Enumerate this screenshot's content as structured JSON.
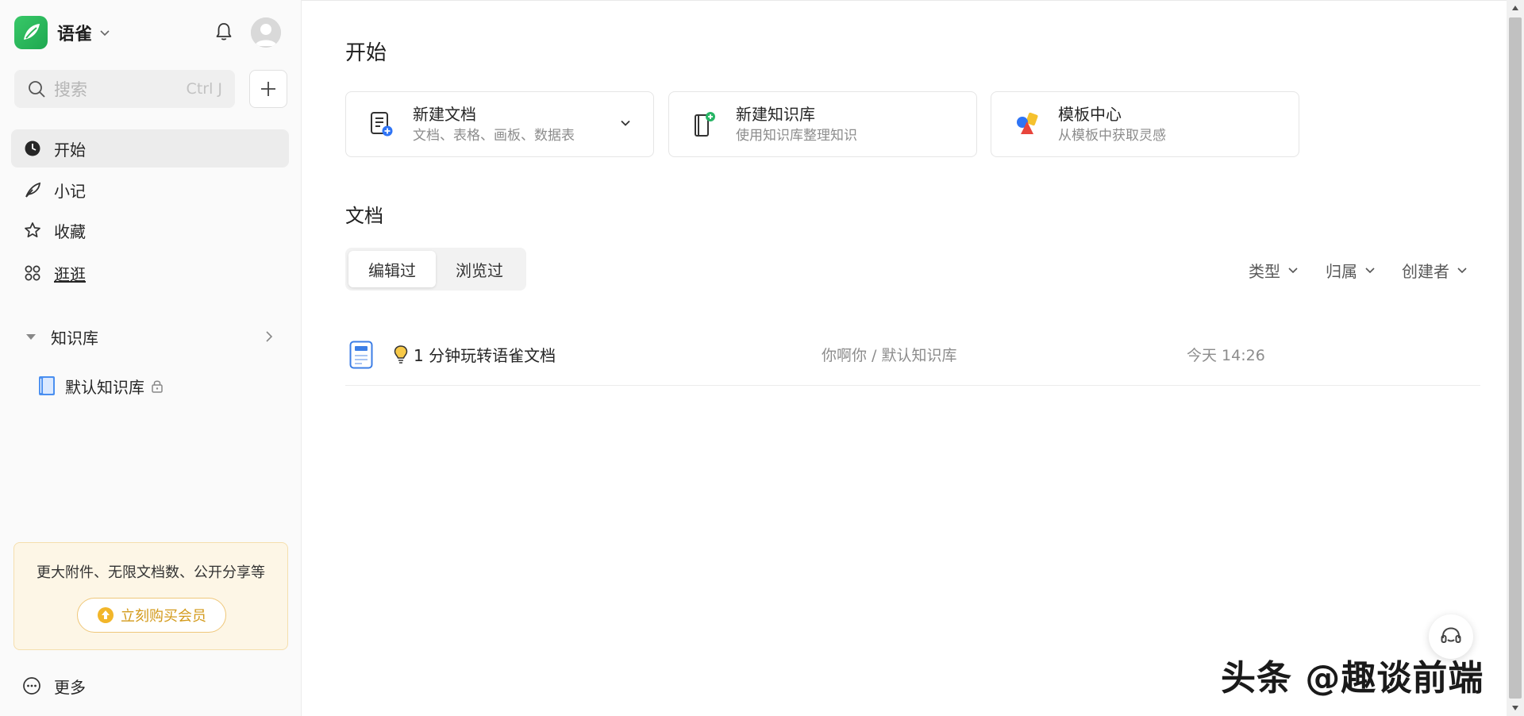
{
  "brand": {
    "name": "语雀",
    "accent": "#2fb85a"
  },
  "search": {
    "placeholder": "搜索",
    "shortcut": "Ctrl J"
  },
  "sidebar": {
    "nav": [
      {
        "label": "开始",
        "icon": "clock-icon",
        "active": true
      },
      {
        "label": "小记",
        "icon": "feather-icon"
      },
      {
        "label": "收藏",
        "icon": "star-icon"
      },
      {
        "label": "逛逛",
        "icon": "grid-icon"
      }
    ],
    "knowledge": {
      "label": "知识库",
      "items": [
        {
          "label": "默认知识库",
          "icon": "book-icon",
          "locked": true
        }
      ]
    },
    "promo": {
      "text": "更大附件、无限文档数、公开分享等",
      "button": "立刻购买会员",
      "color": "#d39a1b"
    },
    "more": "更多"
  },
  "main": {
    "title": "开始",
    "quick_actions": [
      {
        "title": "新建文档",
        "subtitle": "文档、表格、画板、数据表",
        "icon": "new-doc-icon",
        "has_dropdown": true
      },
      {
        "title": "新建知识库",
        "subtitle": "使用知识库整理知识",
        "icon": "new-book-icon"
      },
      {
        "title": "模板中心",
        "subtitle": "从模板中获取灵感",
        "icon": "templates-icon"
      }
    ],
    "docs": {
      "title": "文档",
      "tabs": [
        {
          "label": "编辑过",
          "active": true
        },
        {
          "label": "浏览过"
        }
      ],
      "filters": [
        "类型",
        "归属",
        "创建者"
      ],
      "rows": [
        {
          "title": "1 分钟玩转语雀文档",
          "path": "你啊你 / 默认知识库",
          "time": "今天 14:26",
          "emoji": "lightbulb-icon"
        }
      ]
    }
  },
  "watermark": "头条 @趣谈前端"
}
